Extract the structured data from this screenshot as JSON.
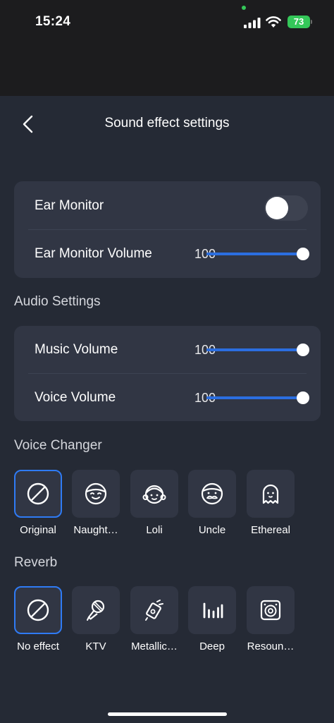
{
  "status_bar": {
    "time": "15:24",
    "battery": "73"
  },
  "header": {
    "title": "Sound effect settings"
  },
  "monitor_card": {
    "ear_monitor_label": "Ear Monitor",
    "ear_monitor_on": false,
    "ear_monitor_volume_label": "Ear Monitor Volume",
    "ear_monitor_volume_value": "100"
  },
  "audio_settings": {
    "title": "Audio Settings",
    "music_volume_label": "Music Volume",
    "music_volume_value": "100",
    "voice_volume_label": "Voice Volume",
    "voice_volume_value": "100"
  },
  "voice_changer": {
    "title": "Voice Changer",
    "options": [
      {
        "label": "Original",
        "icon": "no-effect-icon",
        "selected": true
      },
      {
        "label": "Naught…",
        "icon": "smiling-face-icon",
        "selected": false
      },
      {
        "label": "Loli",
        "icon": "girl-face-icon",
        "selected": false
      },
      {
        "label": "Uncle",
        "icon": "mustache-face-icon",
        "selected": false
      },
      {
        "label": "Ethereal",
        "icon": "ghost-icon",
        "selected": false
      }
    ]
  },
  "reverb": {
    "title": "Reverb",
    "options": [
      {
        "label": "No effect",
        "icon": "no-effect-icon",
        "selected": true
      },
      {
        "label": "KTV",
        "icon": "microphone-icon",
        "selected": false
      },
      {
        "label": "Metallic…",
        "icon": "metallic-mic-icon",
        "selected": false
      },
      {
        "label": "Deep",
        "icon": "equalizer-bars-icon",
        "selected": false
      },
      {
        "label": "Resoun…",
        "icon": "speaker-icon",
        "selected": false
      }
    ]
  },
  "colors": {
    "accent": "#2f7bf5",
    "slider": "#2b6ee0",
    "background": "#252a35",
    "card": "#313644",
    "battery": "#34c759"
  }
}
